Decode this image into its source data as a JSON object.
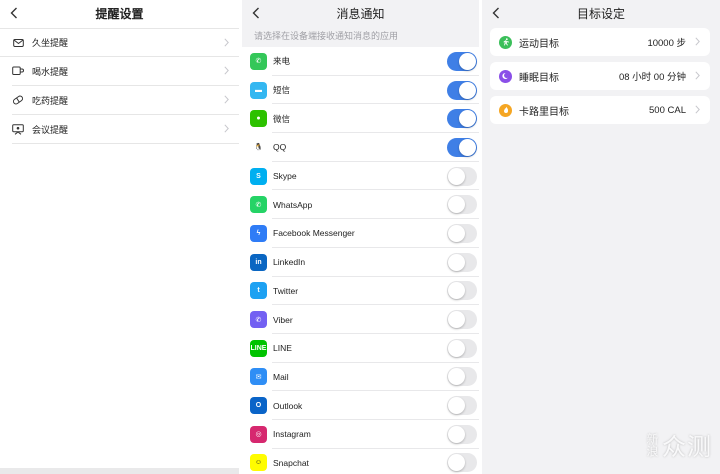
{
  "reminder_settings": {
    "title": "提醒设置",
    "items": [
      {
        "label": "久坐提醒",
        "icon": "envelope-icon"
      },
      {
        "label": "喝水提醒",
        "icon": "cup-icon"
      },
      {
        "label": "吃药提醒",
        "icon": "pill-icon"
      },
      {
        "label": "会议提醒",
        "icon": "meeting-icon"
      }
    ]
  },
  "notifications": {
    "title": "消息通知",
    "hint": "请选择在设备端接收通知消息的应用",
    "apps": [
      {
        "label": "来电",
        "enabled": true,
        "color": "#34c759",
        "glyph": "✆"
      },
      {
        "label": "短信",
        "enabled": true,
        "color": "#34b7f1",
        "glyph": "▬"
      },
      {
        "label": "微信",
        "enabled": true,
        "color": "#2dc100",
        "glyph": "●"
      },
      {
        "label": "QQ",
        "enabled": true,
        "color": "#ffffff",
        "glyph": "🐧"
      },
      {
        "label": "Skype",
        "enabled": false,
        "color": "#00aff0",
        "glyph": "S"
      },
      {
        "label": "WhatsApp",
        "enabled": false,
        "color": "#25d366",
        "glyph": "✆"
      },
      {
        "label": "Facebook Messenger",
        "enabled": false,
        "color": "#2f7cf6",
        "glyph": "ϟ"
      },
      {
        "label": "LinkedIn",
        "enabled": false,
        "color": "#0a66c2",
        "glyph": "in"
      },
      {
        "label": "Twitter",
        "enabled": false,
        "color": "#1da1f2",
        "glyph": "t"
      },
      {
        "label": "Viber",
        "enabled": false,
        "color": "#7360f2",
        "glyph": "✆"
      },
      {
        "label": "LINE",
        "enabled": false,
        "color": "#00c300",
        "glyph": "LINE"
      },
      {
        "label": "Mail",
        "enabled": false,
        "color": "#2f8ef5",
        "glyph": "✉"
      },
      {
        "label": "Outlook",
        "enabled": false,
        "color": "#0a64c8",
        "glyph": "O"
      },
      {
        "label": "Instagram",
        "enabled": false,
        "color": "#d6286f",
        "glyph": "◎"
      },
      {
        "label": "Snapchat",
        "enabled": false,
        "color": "#fffc00",
        "glyph": "☺"
      }
    ]
  },
  "goal_settings": {
    "title": "目标设定",
    "items": [
      {
        "label": "运动目标",
        "value": "10000 步",
        "color": "#3bbf5a",
        "icon": "running-icon"
      },
      {
        "label": "睡眠目标",
        "value": "08 小时 00 分钟",
        "color": "#8a4fe8",
        "icon": "moon-icon"
      },
      {
        "label": "卡路里目标",
        "value": "500 CAL",
        "color": "#f5a623",
        "icon": "flame-icon"
      }
    ]
  },
  "watermark": {
    "small": "新浪",
    "big": "众测"
  }
}
